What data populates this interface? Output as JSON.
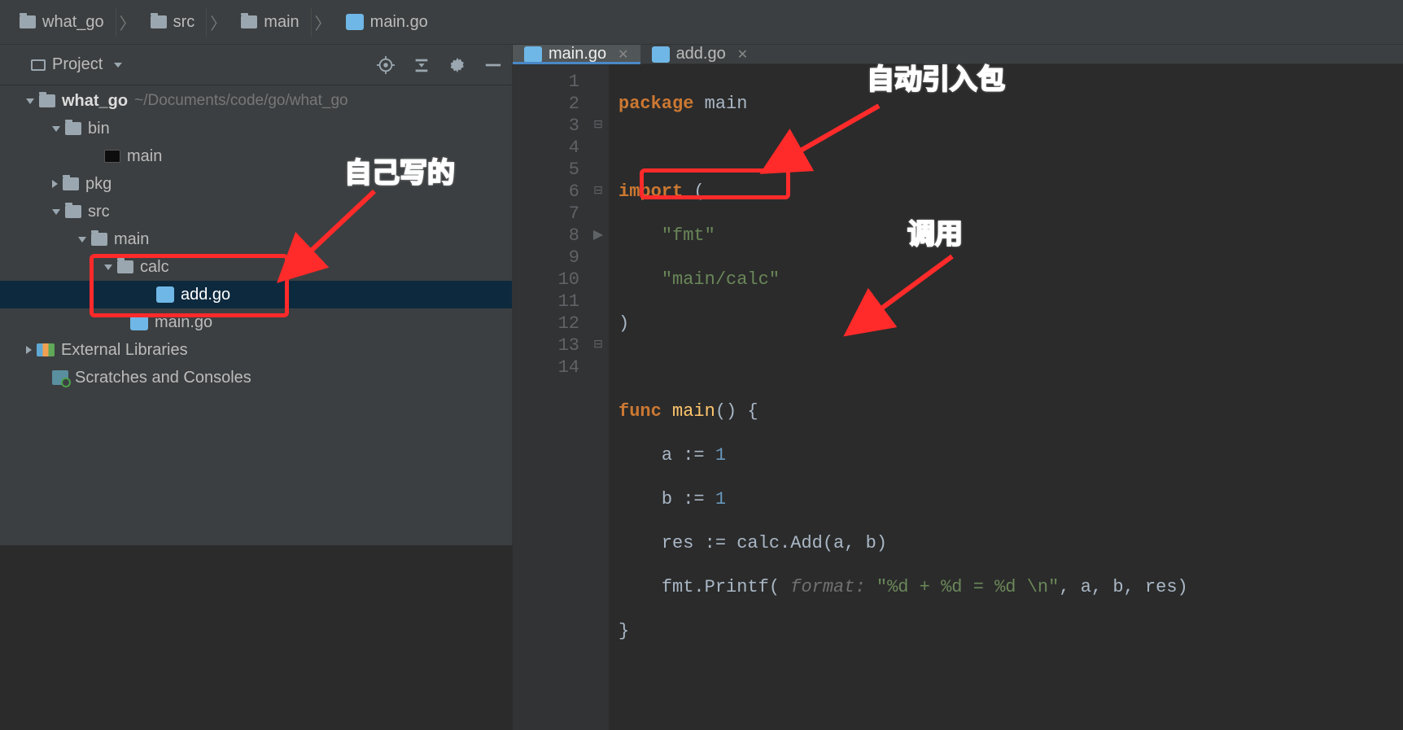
{
  "breadcrumb": {
    "items": [
      {
        "label": "what_go",
        "icon": "folder"
      },
      {
        "label": "src",
        "icon": "folder"
      },
      {
        "label": "main",
        "icon": "folder"
      },
      {
        "label": "main.go",
        "icon": "go"
      }
    ]
  },
  "sidebar": {
    "title": "Project",
    "tree": {
      "root": {
        "label": "what_go",
        "path": "~/Documents/code/go/what_go"
      },
      "bin": {
        "label": "bin"
      },
      "bin_main": {
        "label": "main"
      },
      "pkg": {
        "label": "pkg"
      },
      "src": {
        "label": "src"
      },
      "src_main": {
        "label": "main"
      },
      "calc": {
        "label": "calc"
      },
      "add_go": {
        "label": "add.go"
      },
      "main_go": {
        "label": "main.go"
      },
      "ext_lib": {
        "label": "External Libraries"
      },
      "scratches": {
        "label": "Scratches and Consoles"
      }
    }
  },
  "editor": {
    "tabs": [
      {
        "label": "main.go",
        "active": true
      },
      {
        "label": "add.go",
        "active": false
      }
    ],
    "gutter_start": 1,
    "gutter_end": 14
  },
  "code": {
    "package_kw": "package",
    "package_name": "main",
    "import_kw": "import",
    "import_open": "(",
    "imp_fmt": "\"fmt\"",
    "imp_calc": "\"main/calc\"",
    "import_close": ")",
    "func_kw": "func",
    "func_name": "main",
    "func_sig": "() {",
    "line_a": "a := ",
    "val_a": "1",
    "line_b": "b := ",
    "val_b": "1",
    "line_res": "res := calc.Add(a, b)",
    "printf_pre": "fmt.Printf( ",
    "hint_format": "format:",
    "printf_str": "\"%d + %d = %d \\n\"",
    "printf_post": ", a, b, res)",
    "close_brace": "}"
  },
  "annotations": {
    "self_written": "自己写的",
    "auto_import": "自动引入包",
    "call": "调用"
  }
}
